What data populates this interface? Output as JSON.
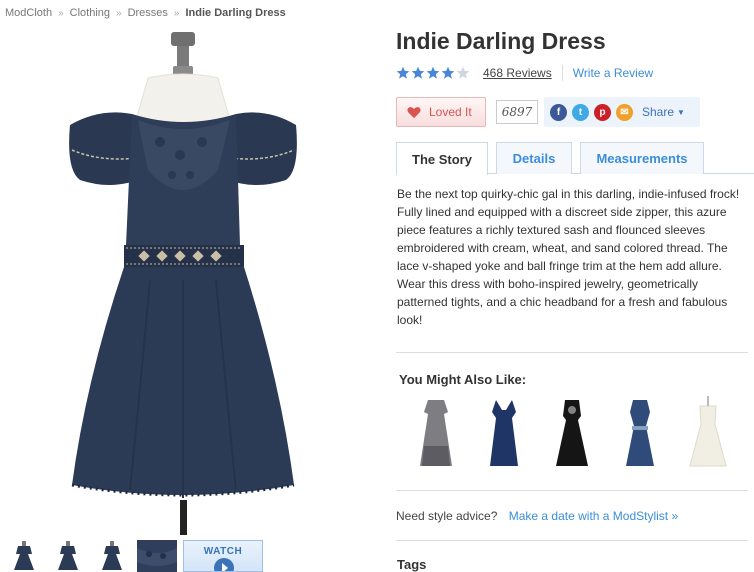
{
  "breadcrumb": {
    "items": [
      "ModCloth",
      "Clothing",
      "Dresses"
    ],
    "current": "Indie Darling Dress",
    "separator": "»"
  },
  "product": {
    "title": "Indie Darling Dress",
    "rating_stars": 4,
    "rating_max": 5,
    "reviews_label": "468 Reviews",
    "write_review_label": "Write a Review"
  },
  "actions": {
    "loved_label": "Loved It",
    "loves_count": "6897",
    "share_label": "Share"
  },
  "tabs": [
    {
      "label": "The Story",
      "active": true
    },
    {
      "label": "Details",
      "active": false
    },
    {
      "label": "Measurements",
      "active": false
    }
  ],
  "story": "Be the next top quirky-chic gal in this darling, indie-infused frock! Fully lined and equipped with a discreet side zipper, this azure piece features a richly textured sash and flounced sleeves embroidered with cream, wheat, and sand colored thread. The lace v-shaped yoke and ball fringe trim at the hem add allure. Wear this dress with boho-inspired jewelry, geometrically patterned tights, and a chic headband for a fresh and fabulous look!",
  "you_might_also_like": {
    "title": "You Might Also Like:",
    "items": [
      {
        "name": "grey-lace-dress",
        "color": "#7d7d82"
      },
      {
        "name": "navy-vneck-dress",
        "color": "#1e3566"
      },
      {
        "name": "black-lace-dress",
        "color": "#151515"
      },
      {
        "name": "blue-belted-dress",
        "color": "#2e4b7a"
      },
      {
        "name": "cream-strapless-dress",
        "color": "#f1efe4"
      }
    ]
  },
  "thumbnails": {
    "watch_label": "WATCH"
  },
  "advice": {
    "question": "Need style advice?",
    "link": "Make a date with a ModStylist »"
  },
  "tags_label": "Tags",
  "colors": {
    "link": "#3b8ed8",
    "dress_navy": "#2c3b55",
    "star_filled": "#4a86d6",
    "star_empty": "#cfd6df",
    "loved": "#d9534f",
    "facebook": "#3b5998",
    "twitter": "#3fa9e6",
    "pinterest": "#cb2027",
    "email": "#f0a02a"
  }
}
